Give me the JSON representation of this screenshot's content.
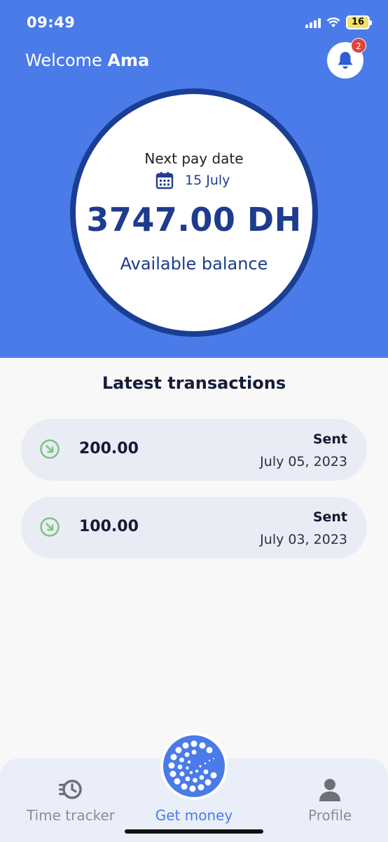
{
  "status_bar": {
    "time": "09:49",
    "battery": "16"
  },
  "header": {
    "welcome_text": "Welcome",
    "user_name": "Ama",
    "notification_count": "2"
  },
  "balance": {
    "next_pay_label": "Next pay date",
    "next_pay_date": "15 July",
    "amount": "3747.00 DH",
    "label": "Available balance"
  },
  "transactions": {
    "title": "Latest transactions",
    "items": [
      {
        "amount": "200.00",
        "status": "Sent",
        "date": "July 05, 2023"
      },
      {
        "amount": "100.00",
        "status": "Sent",
        "date": "July 03, 2023"
      }
    ]
  },
  "nav": {
    "time_tracker": "Time tracker",
    "get_money": "Get money",
    "profile": "Profile"
  },
  "colors": {
    "primary": "#4a7be8",
    "dark_blue": "#1a3e94",
    "received_green": "#7cc47f"
  }
}
